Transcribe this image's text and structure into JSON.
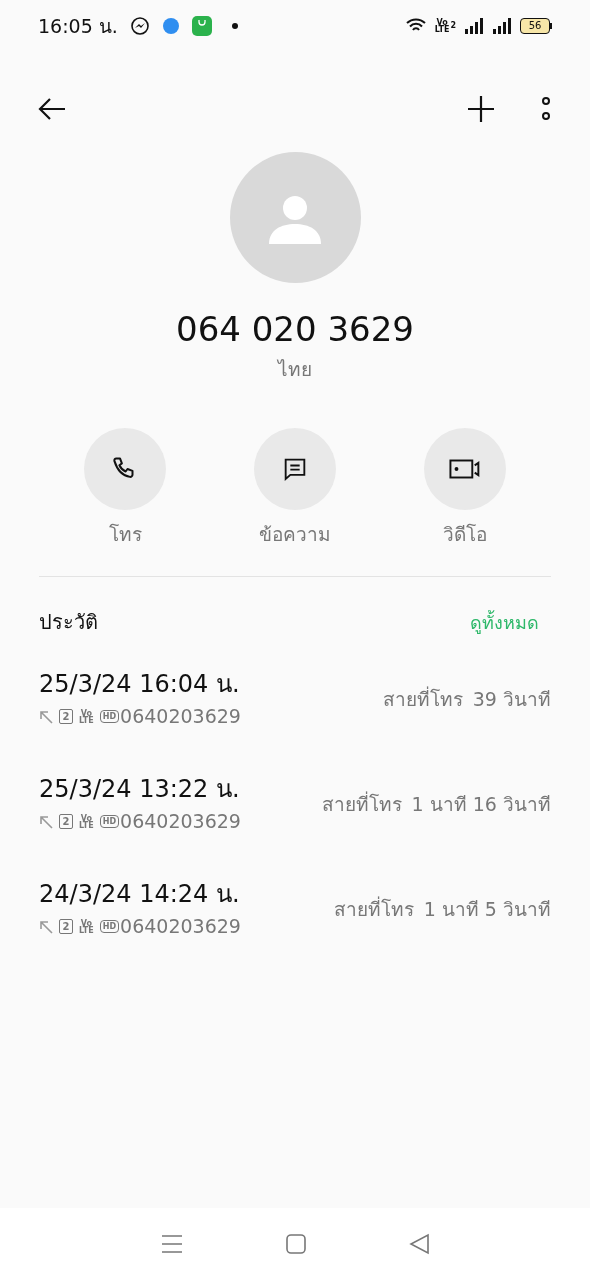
{
  "status_bar": {
    "time": "16:05 น.",
    "volte": [
      "Vo",
      "LTE"
    ],
    "sim": "2",
    "battery": "56"
  },
  "contact": {
    "number": "064 020 3629",
    "location": "ไทย"
  },
  "actions": [
    {
      "kind": "call",
      "label": "โทร"
    },
    {
      "kind": "message",
      "label": "ข้อความ"
    },
    {
      "kind": "video",
      "label": "วิดีโอ"
    }
  ],
  "history": {
    "title": "ประวัติ",
    "see_all": "ดูทั้งหมด",
    "calls": [
      {
        "datetime": "25/3/24 16:04 น.",
        "sim": "2",
        "volte": [
          "Vo",
          "LTE"
        ],
        "hd": "HD",
        "number": "0640203629",
        "type": "สายที่โทร",
        "duration": "39 วินาที"
      },
      {
        "datetime": "25/3/24 13:22 น.",
        "sim": "2",
        "volte": [
          "Vo",
          "LTE"
        ],
        "hd": "HD",
        "number": "0640203629",
        "type": "สายที่โทร",
        "duration": "1 นาที 16 วินาที"
      },
      {
        "datetime": "24/3/24 14:24 น.",
        "sim": "2",
        "volte": [
          "Vo",
          "LTE"
        ],
        "hd": "HD",
        "number": "0640203629",
        "type": "สายที่โทร",
        "duration": "1 นาที 5 วินาที"
      }
    ]
  }
}
